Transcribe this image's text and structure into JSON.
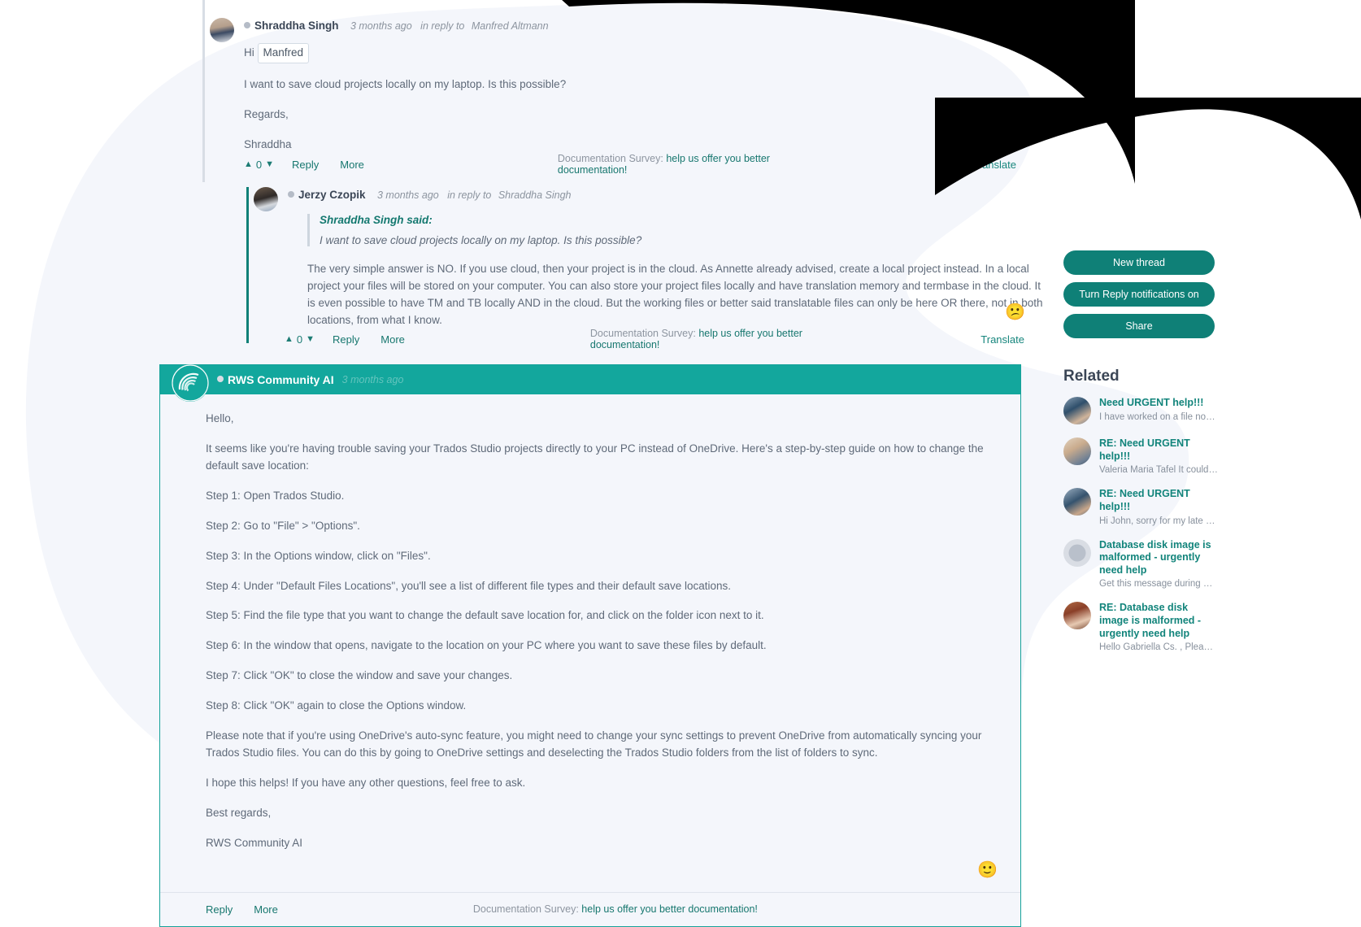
{
  "posts": [
    {
      "id": "post-shraddha",
      "author": "Shraddha Singh",
      "time": "3 months ago",
      "reply_to_prefix": "in reply to",
      "reply_to": "Manfred Altmann",
      "greeting_prefix": "Hi",
      "mention": "Manfred",
      "paragraphs": [
        "I want to save cloud projects locally on my laptop. Is this possible?",
        "Regards,",
        "Shraddha"
      ],
      "actions": {
        "vote_count": "0",
        "reply_label": "Reply",
        "more_label": "More",
        "survey_prefix": "Documentation Survey:",
        "survey_link": "help us offer you better documentation!",
        "translate_label": "Translate"
      }
    },
    {
      "id": "post-jerzy",
      "author": "Jerzy Czopik",
      "time": "3 months ago",
      "reply_to_prefix": "in reply to",
      "reply_to": "Shraddha Singh",
      "quote_title": "Shraddha Singh said:",
      "quote_text": "I want to save cloud projects locally on my laptop. Is this possible?",
      "paragraphs": [
        "The very simple answer is NO. If you use cloud, then your project is in the cloud. As Annette already advised, create a local project instead. In a local project your files will be stored on your computer. You can also store your project files locally and have translation memory and termbase in the cloud. It is even possible to have TM and TB locally AND in the cloud. But the working files or better said translatable files can only be here OR there, not in both locations, from what I know."
      ],
      "reaction": "😕",
      "actions": {
        "vote_count": "0",
        "reply_label": "Reply",
        "more_label": "More",
        "survey_prefix": "Documentation Survey:",
        "survey_link": "help us offer you better documentation!",
        "translate_label": "Translate"
      }
    }
  ],
  "ai_post": {
    "author": "RWS Community AI",
    "time": "3 months ago",
    "logo_name": "rws-community-ai-logo",
    "reaction": "🙂",
    "paragraphs": [
      "Hello,",
      "It seems like you're having trouble saving your Trados Studio projects directly to your PC instead of OneDrive. Here's a step-by-step guide on how to change the default save location:",
      "Step 1: Open Trados Studio.",
      "Step 2: Go to \"File\" > \"Options\".",
      "Step 3: In the Options window, click on \"Files\".",
      "Step 4: Under \"Default Files Locations\", you'll see a list of different file types and their default save locations.",
      "Step 5: Find the file type that you want to change the default save location for, and click on the folder icon next to it.",
      "Step 6: In the window that opens, navigate to the location on your PC where you want to save these files by default.",
      "Step 7: Click \"OK\" to close the window and save your changes.",
      "Step 8: Click \"OK\" again to close the Options window.",
      "Please note that if you're using OneDrive's auto-sync feature, you might need to change your sync settings to prevent OneDrive from automatically syncing your Trados Studio files. You can do this by going to OneDrive settings and deselecting the Trados Studio folders from the list of folders to sync.",
      "I hope this helps! If you have any other questions, feel free to ask.",
      "Best regards,",
      "RWS Community AI"
    ],
    "actions": {
      "reply_label": "Reply",
      "more_label": "More",
      "survey_prefix": "Documentation Survey:",
      "survey_link": "help us offer you better documentation!"
    }
  },
  "sidebar": {
    "buttons": [
      {
        "label": "New thread",
        "name": "new-thread-button"
      },
      {
        "label": "Turn Reply notifications on",
        "name": "turn-reply-notifications-on-button"
      },
      {
        "label": "Share",
        "name": "share-button"
      }
    ],
    "related_title": "Related",
    "related": [
      {
        "title": "Need URGENT help!!!",
        "snippet": "I have worked on a file nor…"
      },
      {
        "title": "RE: Need URGENT help!!!",
        "snippet": "Valeria Maria Tafel It could …"
      },
      {
        "title": "RE: Need URGENT help!!!",
        "snippet": "Hi John, sorry for my late re…"
      },
      {
        "title": "Database disk image is malformed - urgently need help",
        "snippet": "Get this message during my …"
      },
      {
        "title": "RE: Database disk image is malformed - urgently need help",
        "snippet": "Hello Gabriella Cs. , Plea…"
      }
    ]
  },
  "colors": {
    "teal": "#0f8077",
    "teal_bright": "#13a79d",
    "link": "#17776f",
    "page_bg": "#f4f6fb"
  }
}
